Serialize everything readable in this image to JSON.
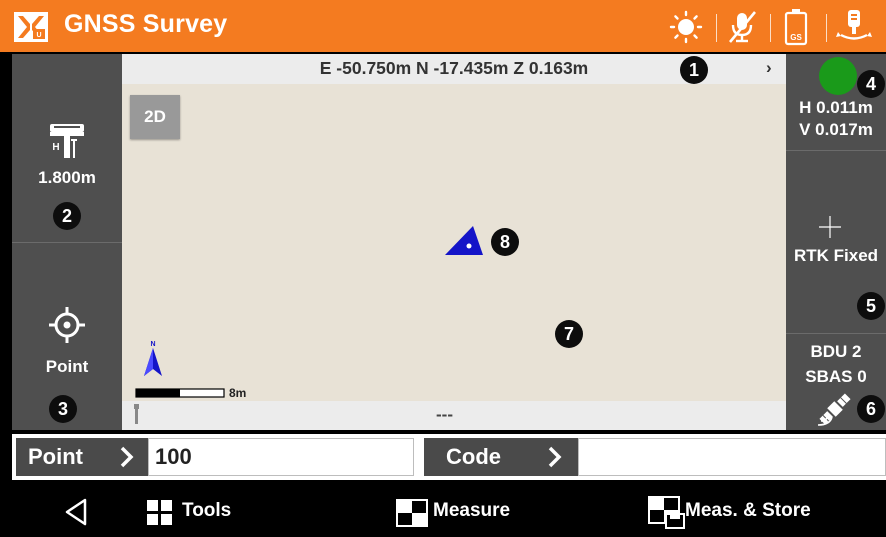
{
  "app": {
    "title": "GNSS Survey"
  },
  "toolbar": {
    "icons": [
      "sun-icon",
      "mute-icon",
      "battery-gs-icon",
      "receiver-connect-icon"
    ],
    "battery_label": "GS"
  },
  "coords": {
    "text": "E -50.750m N -17.435m Z 0.163m",
    "chevron": "›"
  },
  "left_panel": {
    "antenna_height": "1.800m",
    "antenna_h_mark": "H",
    "mode": "Point"
  },
  "map": {
    "view_button": "2D",
    "north_label": "N",
    "scale": "8m",
    "status": "---"
  },
  "right_panel": {
    "h_precision": "H 0.011m",
    "v_precision": "V 0.017m",
    "solution": "RTK Fixed",
    "bdu": "BDU 2",
    "sbas": "SBAS 0",
    "fix_color": "#1a9a1a"
  },
  "callouts": [
    "1",
    "2",
    "3",
    "4",
    "5",
    "6",
    "7",
    "8"
  ],
  "input_row": {
    "point_label": "Point",
    "point_value": "100",
    "code_label": "Code",
    "code_value": ""
  },
  "bottom_nav": {
    "tools": "Tools",
    "measure": "Measure",
    "meas_store": "Meas. & Store"
  },
  "colors": {
    "accent": "#f47b20",
    "panel": "#4f4f4f",
    "map": "#e8e2d6",
    "marker": "#1414c8"
  }
}
